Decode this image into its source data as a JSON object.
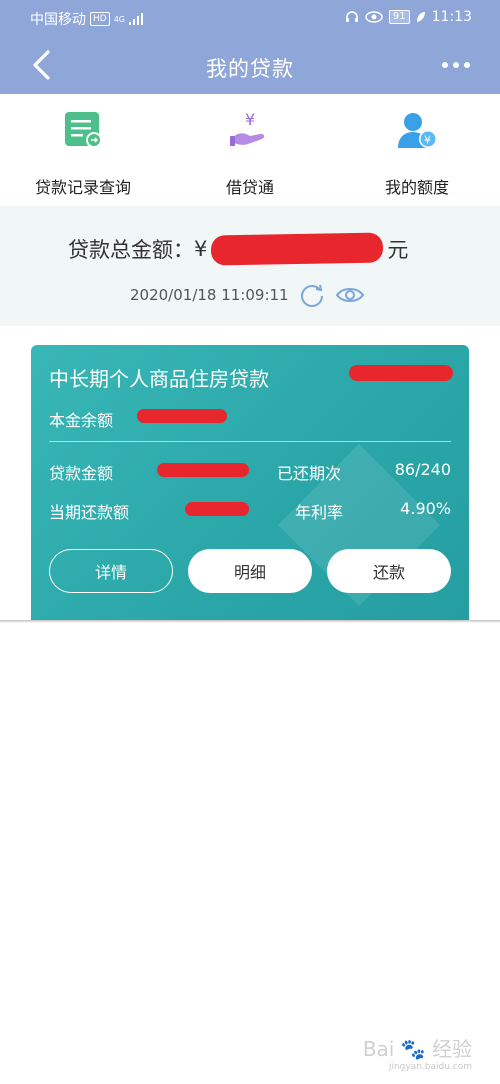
{
  "status_bar": {
    "carrier": "中国移动",
    "hd_badge": "HD",
    "network": "4G",
    "battery": "91",
    "time": "11:13"
  },
  "nav": {
    "title": "我的贷款",
    "back_icon": "chevron-left-icon",
    "more_icon": "more-dots-icon"
  },
  "quick_menu": [
    {
      "label": "贷款记录查询",
      "icon": "loan-record-icon",
      "color": "#4cbf8a"
    },
    {
      "label": "借贷通",
      "icon": "hand-yuan-icon",
      "color": "#9b6ad6"
    },
    {
      "label": "我的额度",
      "icon": "user-yuan-icon",
      "color": "#3aa0e8"
    }
  ],
  "summary": {
    "total_label": "贷款总金额：",
    "currency_symbol": "¥",
    "unit": "元",
    "timestamp": "2020/01/18 11:09:11"
  },
  "loan_card": {
    "title": "中长期个人商品住房贷款",
    "principal_label": "本金余额",
    "loan_amount_label": "贷款金额",
    "repaid_periods_label": "已还期次",
    "repaid_periods_value": "86/240",
    "current_payment_label": "当期还款额",
    "annual_rate_label": "年利率",
    "annual_rate_value": "4.90%",
    "buttons": {
      "details": "详情",
      "breakdown": "明细",
      "repay": "还款"
    },
    "card_color": "#2fadaf"
  },
  "watermark": {
    "brand": "Bai",
    "brand2": "经验",
    "url": "jingyan.baidu.com"
  }
}
